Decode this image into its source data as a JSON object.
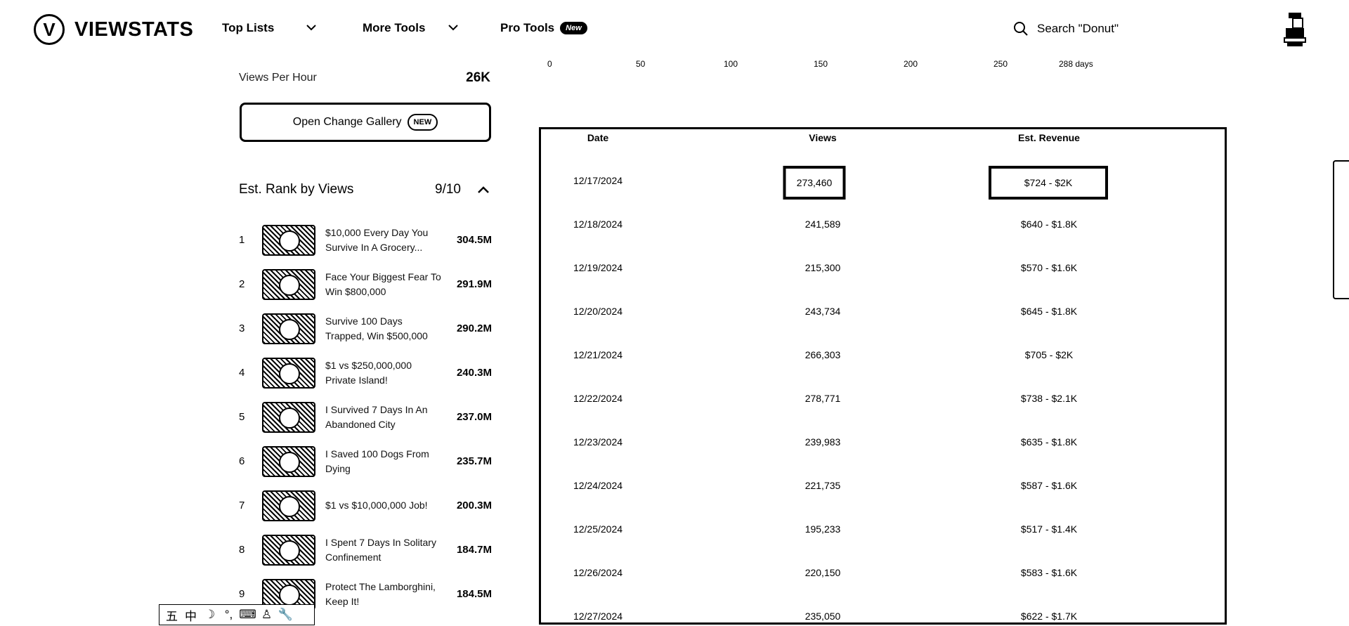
{
  "header": {
    "logo_mark": "V",
    "logo_text": "VIEWSTATS",
    "nav": [
      {
        "label": "Top Lists"
      },
      {
        "label": "More Tools"
      },
      {
        "label": "Pro Tools",
        "badge": "New"
      }
    ],
    "search_placeholder": "Search \"Donut\"",
    "icons": {
      "search": "search-icon",
      "chevron": "chevron-down-icon",
      "avatar": "avatar-image"
    }
  },
  "sidebar": {
    "views_per_hour_label": "Views Per Hour",
    "views_per_hour_value": "26K",
    "gallery_button_label": "Open Change Gallery",
    "gallery_button_badge": "NEW",
    "rank_title": "Est. Rank by Views",
    "rank_count": "9/10",
    "ranks": [
      {
        "rank": "1",
        "title": "$10,000 Every Day You Survive In A Grocery...",
        "views": "304.5M"
      },
      {
        "rank": "2",
        "title": "Face Your Biggest Fear To Win $800,000",
        "views": "291.9M"
      },
      {
        "rank": "3",
        "title": "Survive 100 Days Trapped, Win $500,000",
        "views": "290.2M"
      },
      {
        "rank": "4",
        "title": "$1 vs $250,000,000 Private Island!",
        "views": "240.3M"
      },
      {
        "rank": "5",
        "title": "I Survived 7 Days In An Abandoned City",
        "views": "237.0M"
      },
      {
        "rank": "6",
        "title": "I Saved 100 Dogs From Dying",
        "views": "235.7M"
      },
      {
        "rank": "7",
        "title": "$1 vs $10,000,000 Job!",
        "views": "200.3M"
      },
      {
        "rank": "8",
        "title": "I Spent 7 Days In Solitary Confinement",
        "views": "184.7M"
      },
      {
        "rank": "9",
        "title": "Protect The Lamborghini, Keep It!",
        "views": "184.5M"
      }
    ]
  },
  "axis": {
    "ticks": [
      "0",
      "50",
      "100",
      "150",
      "200",
      "250",
      "288 days"
    ]
  },
  "table": {
    "headers": [
      "Date",
      "Views",
      "Est. Revenue"
    ],
    "rows": [
      {
        "date": "12/17/2024",
        "views": "273,460",
        "revenue": "$724 - $2K"
      },
      {
        "date": "12/18/2024",
        "views": "241,589",
        "revenue": "$640 - $1.8K"
      },
      {
        "date": "12/19/2024",
        "views": "215,300",
        "revenue": "$570 - $1.6K"
      },
      {
        "date": "12/20/2024",
        "views": "243,734",
        "revenue": "$645 - $1.8K"
      },
      {
        "date": "12/21/2024",
        "views": "266,303",
        "revenue": "$705 - $2K"
      },
      {
        "date": "12/22/2024",
        "views": "278,771",
        "revenue": "$738 - $2.1K"
      },
      {
        "date": "12/23/2024",
        "views": "239,983",
        "revenue": "$635 - $1.8K"
      },
      {
        "date": "12/24/2024",
        "views": "221,735",
        "revenue": "$587 - $1.6K"
      },
      {
        "date": "12/25/2024",
        "views": "195,233",
        "revenue": "$517 - $1.4K"
      },
      {
        "date": "12/26/2024",
        "views": "220,150",
        "revenue": "$583 - $1.6K"
      },
      {
        "date": "12/27/2024",
        "views": "235,050",
        "revenue": "$622 - $1.7K"
      }
    ]
  },
  "ime_toolbar": {
    "items": [
      "五",
      "中",
      "☽",
      "°,",
      "⌨",
      "♙",
      "🔧"
    ]
  }
}
